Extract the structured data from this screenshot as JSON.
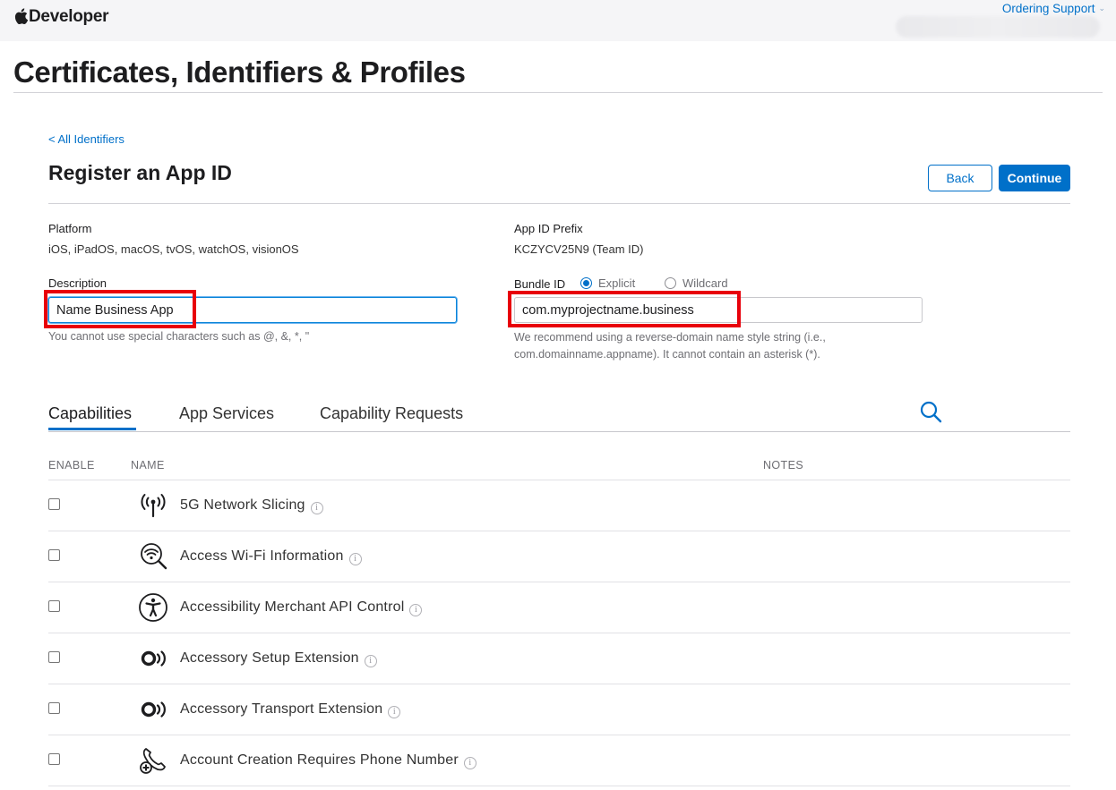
{
  "header": {
    "brand": "Developer",
    "ordering_support": "Ordering Support"
  },
  "page": {
    "title": "Certificates, Identifiers & Profiles",
    "back_link": "< All Identifiers",
    "subtitle": "Register an App ID",
    "back_button": "Back",
    "continue_button": "Continue"
  },
  "form": {
    "platform_label": "Platform",
    "platform_value": "iOS, iPadOS, macOS, tvOS, watchOS, visionOS",
    "prefix_label": "App ID Prefix",
    "prefix_value": "KCZYCV25N9 (Team ID)",
    "description_label": "Description",
    "description_value": "Name Business App",
    "description_hint": "You cannot use special characters such as @, &, *, \"",
    "bundle_label": "Bundle ID",
    "bundle_explicit": "Explicit",
    "bundle_wildcard": "Wildcard",
    "bundle_selected": "Explicit",
    "bundle_value": "com.myprojectname.business",
    "bundle_hint_line1": "We recommend using a reverse-domain name style string (i.e.,",
    "bundle_hint_line2": "com.domainname.appname). It cannot contain an asterisk (*)."
  },
  "tabs": [
    {
      "label": "Capabilities",
      "active": true
    },
    {
      "label": "App Services",
      "active": false
    },
    {
      "label": "Capability Requests",
      "active": false
    }
  ],
  "table": {
    "col_enable": "ENABLE",
    "col_name": "NAME",
    "col_notes": "NOTES",
    "rows": [
      {
        "name": "5G Network Slicing",
        "icon": "antenna-icon",
        "enabled": false
      },
      {
        "name": "Access Wi-Fi Information",
        "icon": "wifi-search-icon",
        "enabled": false
      },
      {
        "name": "Accessibility Merchant API Control",
        "icon": "accessibility-icon",
        "enabled": false
      },
      {
        "name": "Accessory Setup Extension",
        "icon": "accessory-icon",
        "enabled": false
      },
      {
        "name": "Accessory Transport Extension",
        "icon": "accessory-icon",
        "enabled": false
      },
      {
        "name": "Account Creation Requires Phone Number",
        "icon": "phone-add-icon",
        "enabled": false
      }
    ]
  },
  "colors": {
    "accent": "#0070c9",
    "highlight": "#e8000b"
  }
}
